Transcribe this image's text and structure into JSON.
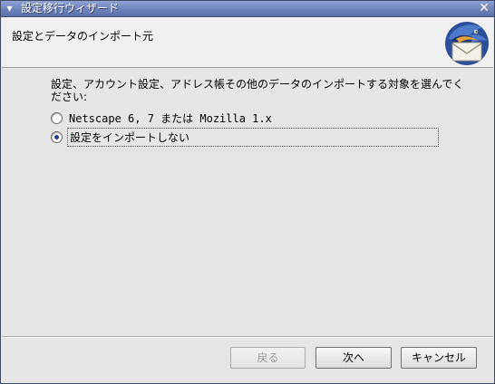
{
  "window": {
    "title": "設定移行ウィザード",
    "menu_glyph": "▾",
    "close_glyph": "✕"
  },
  "header": {
    "title": "設定とデータのインポート元",
    "logo_icon": "thunderbird-logo-icon"
  },
  "content": {
    "description": "設定、アカウント設定、アドレス帳その他のデータのインポートする対象を選んでください:",
    "options": [
      {
        "label": "Netscape 6, 7 または Mozilla 1.x",
        "selected": false
      },
      {
        "label": "設定をインポートしない",
        "selected": true
      }
    ]
  },
  "buttons": {
    "back": "戻る",
    "next": "次へ",
    "cancel": "キャンセル"
  },
  "colors": {
    "titlebar": "#6b80b8",
    "window_bg": "#e6e6e6",
    "header_bg": "#f0f0f0",
    "radio_dot": "#1e3f8a"
  }
}
